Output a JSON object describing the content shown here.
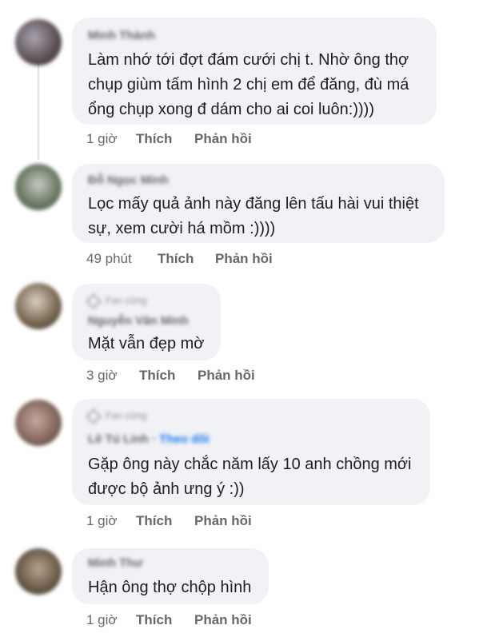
{
  "comments": [
    {
      "name": "Minh Thành",
      "badge": "",
      "follow": "",
      "lines": [
        "Làm nhớ tới đợt đám cưới chị t. Nhờ ông thợ",
        "chụp giùm tấm hình 2 chị em để đăng, đù má",
        "ổng chụp xong đ dám cho ai coi luôn:))))"
      ],
      "time": "1 giờ",
      "like": "Thích",
      "reply": "Phản hồi",
      "avatar_color": "#6b5a55"
    },
    {
      "name": "Đỗ Ngọc Minh",
      "badge": "",
      "follow": "",
      "lines": [
        "Lọc mấy quả ảnh này đăng lên tấu hài vui thiệt",
        "sự, xem cười há mồm :))))"
      ],
      "time": "49 phút",
      "like": "Thích",
      "reply": "Phản hồi",
      "avatar_color": "#5d6b58"
    },
    {
      "name": "Nguyễn Văn Minh",
      "badge": "Fan cứng",
      "follow": "",
      "lines": [
        "Mặt vẫn đẹp mờ"
      ],
      "time": "3 giờ",
      "like": "Thích",
      "reply": "Phản hồi",
      "avatar_color": "#7a6a58"
    },
    {
      "name": "Lê Tú Linh",
      "badge": "Fan cứng",
      "follow": "· Theo dõi",
      "lines": [
        "Gặp ông này chắc năm lấy 10 anh chồng mới",
        "được bộ ảnh ưng ý :))"
      ],
      "time": "1 giờ",
      "like": "Thích",
      "reply": "Phản hồi",
      "avatar_color": "#8a6f66"
    },
    {
      "name": "Minh Thư",
      "badge": "",
      "follow": "",
      "lines": [
        "Hận ông thợ chộp hình"
      ],
      "time": "1 giờ",
      "like": "Thích",
      "reply": "Phản hồi",
      "avatar_color": "#6e5e4c"
    }
  ]
}
